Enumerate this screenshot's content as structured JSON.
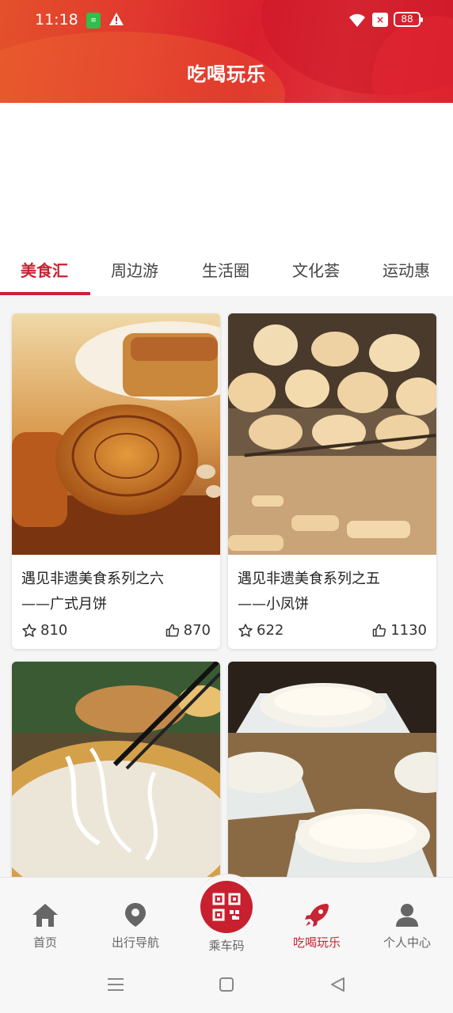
{
  "status_bar": {
    "time": "11:18",
    "battery": "88",
    "sim_label": "≡"
  },
  "header": {
    "title": "吃喝玩乐"
  },
  "tabs": [
    {
      "label": "美食汇",
      "active": true
    },
    {
      "label": "周边游",
      "active": false
    },
    {
      "label": "生活圈",
      "active": false
    },
    {
      "label": "文化荟",
      "active": false
    },
    {
      "label": "运动惠",
      "active": false
    }
  ],
  "cards": [
    {
      "title_line1": "遇见非遗美食系列之六",
      "title_line2": "——广式月饼",
      "stars": "810",
      "likes": "870",
      "image": "mooncake-photo"
    },
    {
      "title_line1": "遇见非遗美食系列之五",
      "title_line2": "——小凤饼",
      "stars": "622",
      "likes": "1130",
      "image": "fried-pastry-photo"
    },
    {
      "title_line1": "",
      "title_line2": "",
      "stars": "",
      "likes": "",
      "image": "rice-noodle-photo"
    },
    {
      "title_line1": "",
      "title_line2": "",
      "stars": "",
      "likes": "",
      "image": "tofu-pudding-photo"
    }
  ],
  "bottom_nav": [
    {
      "label": "首页",
      "icon": "home-icon",
      "active": false
    },
    {
      "label": "出行导航",
      "icon": "location-pin-icon",
      "active": false
    },
    {
      "label": "乘车码",
      "icon": "qr-code-icon",
      "active": false
    },
    {
      "label": "吃喝玩乐",
      "icon": "rocket-icon",
      "active": true
    },
    {
      "label": "个人中心",
      "icon": "user-icon",
      "active": false
    }
  ],
  "colors": {
    "accent": "#c72434",
    "header": "#d91f2d"
  }
}
